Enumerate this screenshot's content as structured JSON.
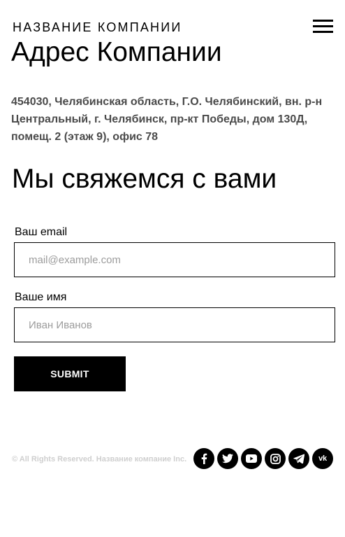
{
  "header": {
    "company_name": "НАЗВАНИЕ КОМПАНИИ",
    "menu_icon": "hamburger-menu-icon"
  },
  "address": {
    "title": "Адрес Компании",
    "text": "454030, Челябинская область, Г.О. Челябинский, вн. р-н Центральный, г. Челябинск, пр-кт Победы, дом 130Д, помещ. 2 (этаж 9), офис 78"
  },
  "contact_form": {
    "title": "Мы свяжемся с вами",
    "email_label": "Ваш email",
    "email_placeholder": "mail@example.com",
    "email_value": "",
    "name_label": "Ваше имя",
    "name_placeholder": "Иван Иванов",
    "name_value": "",
    "submit_label": "SUBMIT"
  },
  "footer": {
    "copyright": "© All Rights Reserved. Название компание Inc.",
    "social": [
      {
        "name": "facebook",
        "icon": "facebook-icon"
      },
      {
        "name": "twitter",
        "icon": "twitter-icon"
      },
      {
        "name": "youtube",
        "icon": "youtube-icon"
      },
      {
        "name": "instagram",
        "icon": "instagram-icon"
      },
      {
        "name": "telegram",
        "icon": "telegram-icon"
      },
      {
        "name": "vk",
        "icon": "vk-icon",
        "text": "vk"
      }
    ]
  },
  "colors": {
    "background": "#ffffff",
    "text": "#000000",
    "address_text": "#4a4a4a",
    "copyright_text": "#cfcfcf",
    "placeholder": "#9c9c9c",
    "button_bg": "#000000",
    "button_text": "#ffffff"
  }
}
